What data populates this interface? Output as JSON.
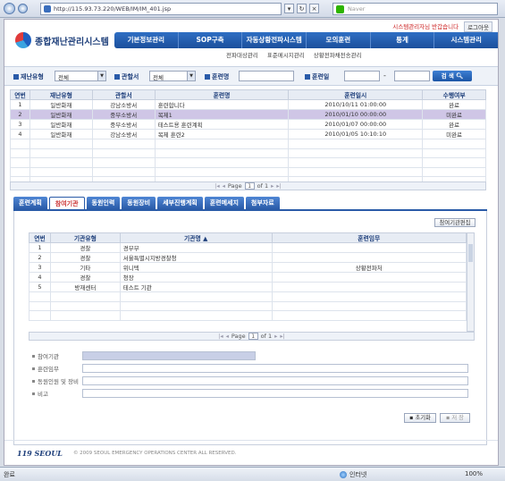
{
  "browser": {
    "url": "http://115.93.73.220/WEB/IM/IM_401.jsp",
    "search_placeholder": "Naver"
  },
  "header": {
    "app_title": "종합재난관리시스템",
    "session_msg": "시스템관리자님 반갑습니다",
    "logout": "로그아웃"
  },
  "gnb": [
    "기본정보관리",
    "SOP구축",
    "자동상황전파시스템",
    "모의훈련",
    "통계",
    "시스템관리"
  ],
  "gnb_sub": [
    "전파대상관리",
    "표준메시지관리",
    "상황전파채전송관리"
  ],
  "search": {
    "disaster_type_label": "재난유형",
    "disaster_type_value": "전체",
    "org_label": "관할서",
    "org_value": "전체",
    "training_name_label": "훈련명",
    "training_date_label": "훈련일",
    "date_dash": "-",
    "search_button": "검 색"
  },
  "training_table": {
    "columns": [
      "연번",
      "재난유형",
      "관할서",
      "훈련명",
      "훈련일시",
      "수행여부"
    ],
    "rows": [
      [
        "1",
        "일반화재",
        "강남소방서",
        "훈련합니다",
        "2010/10/11 01:00:00",
        "완료"
      ],
      [
        "2",
        "일반화재",
        "중부소방서",
        "복제1",
        "2010/01/10 00:00:00",
        "미완료"
      ],
      [
        "3",
        "일반화재",
        "중부소방서",
        "테스트용 훈련계획",
        "2010/01/07 00:00:00",
        "완료"
      ],
      [
        "4",
        "일반화재",
        "강남소방서",
        "복제 훈련2",
        "2010/01/05 10:10:10",
        "미완료"
      ]
    ],
    "empty_rows": 5,
    "selected_row": 1,
    "pager": {
      "page_label": "Page",
      "page": "1",
      "of_label": "of 1"
    }
  },
  "tabs": [
    "훈련계획",
    "참여기관",
    "동원인력",
    "동원장비",
    "세부진행계획",
    "훈련메세지",
    "첨부자료"
  ],
  "active_tab": 1,
  "participants": {
    "edit_button": "참여기관편집",
    "columns": [
      "연번",
      "기관유형",
      "기관명 ▲",
      "훈련임무"
    ],
    "rows": [
      [
        "1",
        "경찰",
        "경부부",
        ""
      ],
      [
        "2",
        "경찰",
        "서울특별시지방경찰청",
        ""
      ],
      [
        "3",
        "기타",
        "위니텍",
        "상황전파처"
      ],
      [
        "4",
        "경찰",
        "청장",
        ""
      ],
      [
        "5",
        "방재센터",
        "테스트 기관",
        ""
      ]
    ],
    "empty_rows": 3,
    "pager": {
      "page_label": "Page",
      "page": "1",
      "of_label": "of 1"
    }
  },
  "form": {
    "fields": [
      "참여기관",
      "훈련임무",
      "동원인원 및 장비",
      "비고"
    ],
    "init_button": "초기화",
    "save_button": "저 장"
  },
  "footer": {
    "logo": "119 SEOUL",
    "copyright": "© 2009 SEOUL EMERGENCY OPERATIONS CENTER ALL RESERVED."
  },
  "status": {
    "left": "완료",
    "zone": "인터넷",
    "zoom": "100%"
  }
}
